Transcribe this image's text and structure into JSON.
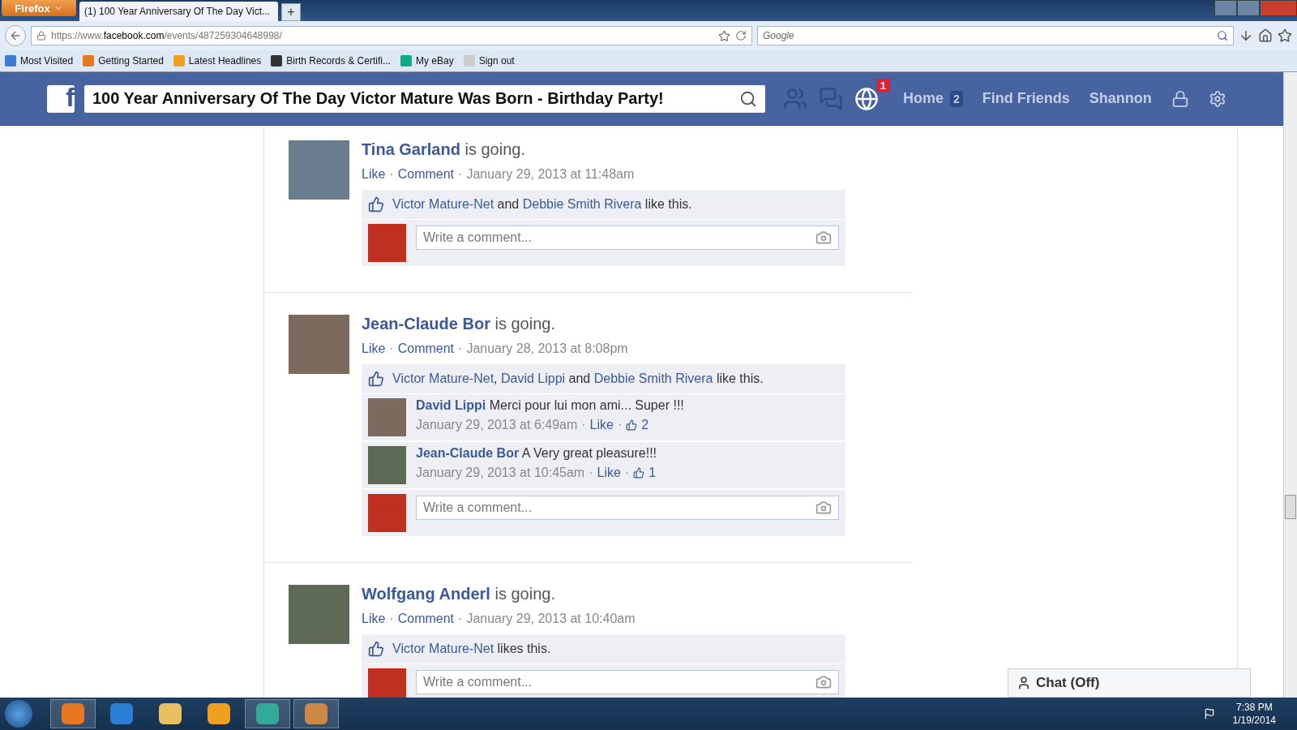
{
  "browser": {
    "menu_button": "Firefox",
    "tabs": [
      {
        "title": "(1) 100 Year Anniversary Of The Day Vict...",
        "selected": true
      }
    ],
    "new_tab": "+",
    "url": {
      "prefix": "https://www.",
      "domain": "facebook.com",
      "path": "/events/487259304648998/"
    },
    "search_placeholder": "Google",
    "bookmarks": [
      "Most Visited",
      "Getting Started",
      "Latest Headlines",
      "Birth Records & Certifi...",
      "My eBay",
      "Sign out"
    ]
  },
  "header": {
    "logo": "f",
    "search_value": "100 Year Anniversary Of The Day Victor Mature Was Born - Birthday Party!",
    "notification_count": "1",
    "nav": [
      {
        "label": "Home",
        "count": "2"
      },
      {
        "label": "Find Friends"
      },
      {
        "label": "Shannon"
      }
    ]
  },
  "posts": [
    {
      "name": "Tina Garland",
      "status": "is going.",
      "meta": [
        {
          "text": "Like",
          "kind": "link"
        },
        {
          "text": "·",
          "kind": "sep"
        },
        {
          "text": "Comment",
          "kind": "link"
        },
        {
          "text": "·",
          "kind": "sep"
        },
        {
          "text": "January 29, 2013 at 11:48am",
          "kind": "time"
        }
      ],
      "likes": [
        {
          "text": "Victor Mature-Net",
          "kind": "link"
        },
        {
          "text": " and ",
          "kind": "plain"
        },
        {
          "text": "Debbie Smith Rivera",
          "kind": "link"
        },
        {
          "text": " like this.",
          "kind": "plain"
        }
      ],
      "comment_placeholder": "Write a comment..."
    },
    {
      "name": "Jean-Claude Bor",
      "status": "is going.",
      "meta": [
        {
          "text": "Like",
          "kind": "link"
        },
        {
          "text": "·",
          "kind": "sep"
        },
        {
          "text": "Comment",
          "kind": "link"
        },
        {
          "text": "·",
          "kind": "sep"
        },
        {
          "text": "January 28, 2013 at 8:08pm",
          "kind": "time"
        }
      ],
      "likes": [
        {
          "text": "Victor Mature-Net",
          "kind": "link"
        },
        {
          "text": ", ",
          "kind": "plain"
        },
        {
          "text": "David Lippi",
          "kind": "link"
        },
        {
          "text": " and ",
          "kind": "plain"
        },
        {
          "text": "Debbie Smith Rivera",
          "kind": "link"
        },
        {
          "text": " like this.",
          "kind": "plain"
        }
      ],
      "comments": [
        {
          "name": "David Lippi",
          "text": "Merci pour lui mon ami... Super !!!",
          "meta": [
            {
              "text": "January 29, 2013 at 6:49am",
              "kind": "time"
            },
            {
              "text": "·",
              "kind": "sep"
            },
            {
              "text": "Like",
              "kind": "link"
            },
            {
              "text": "·",
              "kind": "sep"
            },
            {
              "text": "2",
              "kind": "likes"
            }
          ]
        },
        {
          "name": "Jean-Claude Bor",
          "text": "A Very great pleasure!!!",
          "meta": [
            {
              "text": "January 29, 2013 at 10:45am",
              "kind": "time"
            },
            {
              "text": "·",
              "kind": "sep"
            },
            {
              "text": "Like",
              "kind": "link"
            },
            {
              "text": "·",
              "kind": "sep"
            },
            {
              "text": "1",
              "kind": "likes"
            }
          ]
        }
      ],
      "comment_placeholder": "Write a comment..."
    },
    {
      "name": "Wolfgang Anderl",
      "status": "is going.",
      "meta": [
        {
          "text": "Like",
          "kind": "link"
        },
        {
          "text": "·",
          "kind": "sep"
        },
        {
          "text": "Comment",
          "kind": "link"
        },
        {
          "text": "·",
          "kind": "sep"
        },
        {
          "text": "January 29, 2013 at 10:40am",
          "kind": "time"
        }
      ],
      "likes": [
        {
          "text": "Victor Mature-Net",
          "kind": "link"
        },
        {
          "text": " likes this.",
          "kind": "plain"
        }
      ],
      "comment_placeholder": "Write a comment..."
    }
  ],
  "chat": "Chat (Off)",
  "taskbar": {
    "time": "7:38 PM",
    "date": "1/19/2014"
  }
}
